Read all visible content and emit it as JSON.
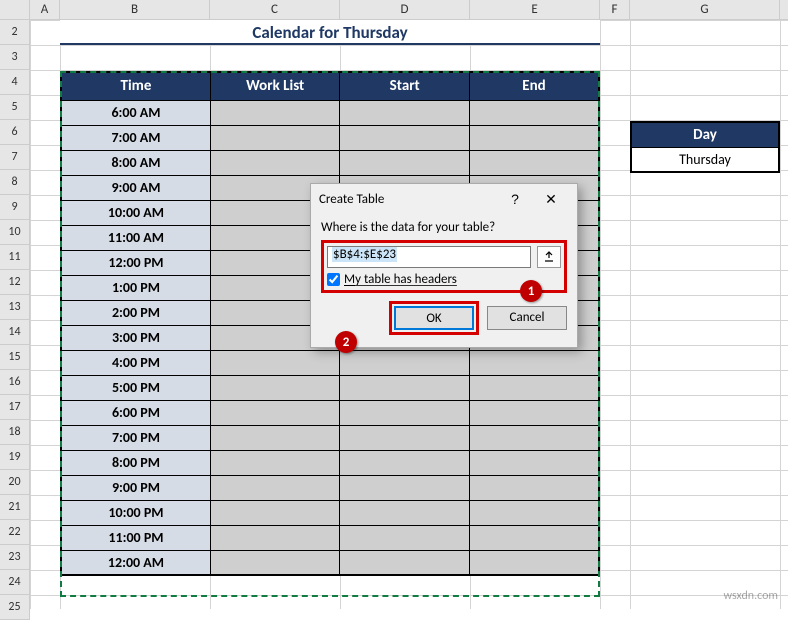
{
  "columns": [
    {
      "label": "A",
      "w": 30
    },
    {
      "label": "B",
      "w": 150
    },
    {
      "label": "C",
      "w": 130
    },
    {
      "label": "D",
      "w": 130
    },
    {
      "label": "E",
      "w": 130
    },
    {
      "label": "F",
      "w": 30
    },
    {
      "label": "G",
      "w": 150
    }
  ],
  "row_start": 2,
  "row_count": 22,
  "title": "Calendar for Thursday",
  "headers": {
    "time": "Time",
    "work": "Work List",
    "start": "Start",
    "end": "End"
  },
  "times": [
    "6:00 AM",
    "7:00 AM",
    "8:00 AM",
    "9:00 AM",
    "10:00 AM",
    "11:00 AM",
    "12:00 PM",
    "1:00 PM",
    "2:00 PM",
    "3:00 PM",
    "4:00 PM",
    "5:00 PM",
    "6:00 PM",
    "7:00 PM",
    "8:00 PM",
    "9:00 PM",
    "10:00 PM",
    "11:00 PM",
    "12:00 AM"
  ],
  "side": {
    "header": "Day",
    "value": "Thursday"
  },
  "dialog": {
    "title": "Create Table",
    "help": "?",
    "close": "✕",
    "question": "Where is the data for your table?",
    "range": "$B$4:$E$23",
    "checkbox": "My table has headers",
    "ok": "OK",
    "cancel": "Cancel",
    "callout1": "1",
    "callout2": "2"
  },
  "watermark": "wsxdn.com"
}
